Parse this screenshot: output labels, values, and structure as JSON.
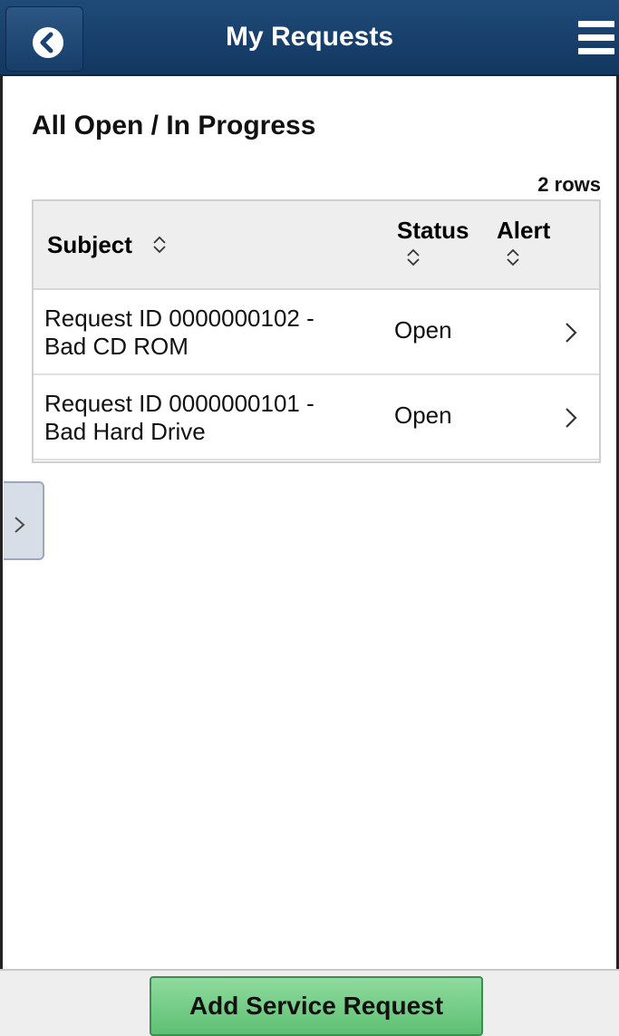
{
  "header": {
    "title": "My Requests",
    "back_icon": "back-arrow-icon",
    "menu_icon": "hamburger-menu-icon"
  },
  "main": {
    "section_title": "All Open / In Progress",
    "row_count": "2 rows",
    "grid": {
      "columns": [
        "Subject",
        "Status",
        "Alert"
      ],
      "rows": [
        {
          "subject_line1": "Request ID 0000000102 -",
          "subject_line2": "Bad CD ROM",
          "status": "Open",
          "alert": ""
        },
        {
          "subject_line1": "Request ID 0000000101 -",
          "subject_line2": "Bad Hard Drive",
          "status": "Open",
          "alert": ""
        }
      ]
    }
  },
  "footer": {
    "add_button_label": "Add Service Request"
  },
  "colors": {
    "header_bg": "#1a4270",
    "add_button": "#6cc87f",
    "grid_header_bg": "#eeeeee"
  }
}
